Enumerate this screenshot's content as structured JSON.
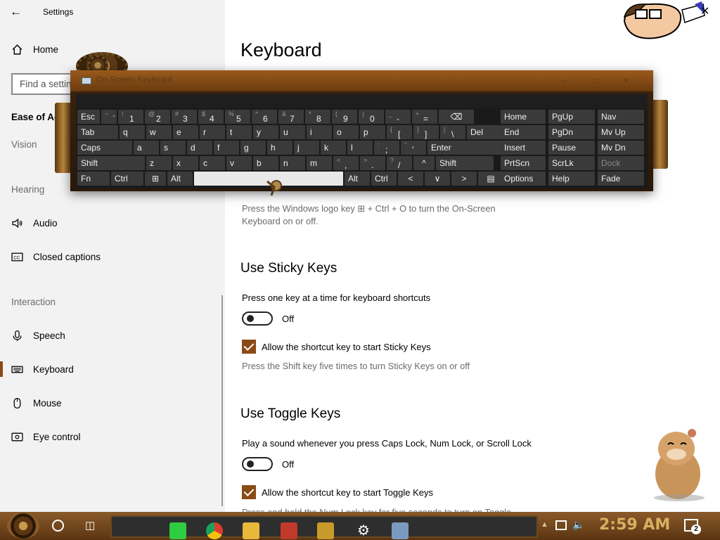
{
  "window": {
    "title": "Settings"
  },
  "sidebar": {
    "home_label": "Home",
    "search_placeholder": "Find a setting",
    "section_title": "Ease of Access",
    "vision_heading": "Vision",
    "hearing_heading": "Hearing",
    "hearing_items": [
      {
        "label": "Audio",
        "icon": "speaker-icon"
      },
      {
        "label": "Closed captions",
        "icon": "closed-captions-icon"
      }
    ],
    "interaction_heading": "Interaction",
    "interaction_items": [
      {
        "label": "Speech",
        "icon": "microphone-icon"
      },
      {
        "label": "Keyboard",
        "icon": "keyboard-icon",
        "selected": true
      },
      {
        "label": "Mouse",
        "icon": "mouse-icon"
      },
      {
        "label": "Eye control",
        "icon": "eye-control-icon"
      }
    ]
  },
  "main": {
    "title": "Keyboard",
    "osk_help_line1": "Press the Windows logo key ⊞ + Ctrl + O to turn the On-Screen",
    "osk_help_line2": "Keyboard on or off.",
    "sticky": {
      "title": "Use Sticky Keys",
      "desc": "Press one key at a time for keyboard shortcuts",
      "toggle_state": "Off",
      "checkbox_label": "Allow the shortcut key to start Sticky Keys",
      "checkbox_checked": true,
      "hint": "Press the Shift key five times to turn Sticky Keys on or off"
    },
    "toggle": {
      "title": "Use Toggle Keys",
      "desc": "Play a sound whenever you press Caps Lock, Num Lock, or Scroll Lock",
      "toggle_state": "Off",
      "checkbox_label": "Allow the shortcut key to start Toggle Keys",
      "checkbox_checked": true,
      "hint": "Press and hold the Num Lock key for five seconds to turn on Toggle"
    }
  },
  "osk": {
    "title": "On-Screen Keyboard",
    "rows": [
      [
        {
          "m": "Esc"
        },
        {
          "s": "~",
          "m": "`"
        },
        {
          "s": "!",
          "m": "1"
        },
        {
          "s": "@",
          "m": "2"
        },
        {
          "s": "#",
          "m": "3"
        },
        {
          "s": "$",
          "m": "4"
        },
        {
          "s": "%",
          "m": "5"
        },
        {
          "s": "^",
          "m": "6"
        },
        {
          "s": "&",
          "m": "7"
        },
        {
          "s": "*",
          "m": "8"
        },
        {
          "s": "(",
          "m": "9"
        },
        {
          "s": ")",
          "m": "0"
        },
        {
          "s": "_",
          "m": "-"
        },
        {
          "s": "+",
          "m": "="
        },
        {
          "m": "⌫"
        }
      ],
      [
        {
          "m": "Tab"
        },
        {
          "m": "q"
        },
        {
          "m": "w"
        },
        {
          "m": "e"
        },
        {
          "m": "r"
        },
        {
          "m": "t"
        },
        {
          "m": "y"
        },
        {
          "m": "u"
        },
        {
          "m": "i"
        },
        {
          "m": "o"
        },
        {
          "m": "p"
        },
        {
          "s": "{",
          "m": "["
        },
        {
          "s": "}",
          "m": "]"
        },
        {
          "s": "|",
          "m": "\\"
        },
        {
          "m": "Del"
        }
      ],
      [
        {
          "m": "Caps"
        },
        {
          "m": "a"
        },
        {
          "m": "s"
        },
        {
          "m": "d"
        },
        {
          "m": "f"
        },
        {
          "m": "g"
        },
        {
          "m": "h"
        },
        {
          "m": "j"
        },
        {
          "m": "k"
        },
        {
          "m": "l"
        },
        {
          "s": ":",
          "m": ";"
        },
        {
          "s": "\"",
          "m": "'"
        },
        {
          "m": "Enter"
        }
      ],
      [
        {
          "m": "Shift"
        },
        {
          "m": "z"
        },
        {
          "m": "x"
        },
        {
          "m": "c"
        },
        {
          "m": "v"
        },
        {
          "m": "b"
        },
        {
          "m": "n"
        },
        {
          "m": "m"
        },
        {
          "s": "<",
          "m": ","
        },
        {
          "s": ">",
          "m": "."
        },
        {
          "s": "?",
          "m": "/"
        },
        {
          "m": "^"
        },
        {
          "m": "Shift"
        }
      ],
      [
        {
          "m": "Fn"
        },
        {
          "m": "Ctrl"
        },
        {
          "m": "⊞"
        },
        {
          "m": "Alt"
        },
        {
          "m": ""
        },
        {
          "m": "Alt"
        },
        {
          "m": "Ctrl"
        },
        {
          "m": "<"
        },
        {
          "m": "∨"
        },
        {
          "m": ">"
        },
        {
          "m": "▤"
        }
      ]
    ],
    "nav_rows": [
      [
        {
          "m": "Home"
        },
        {
          "m": "PgUp"
        },
        {
          "m": "Nav"
        }
      ],
      [
        {
          "m": "End"
        },
        {
          "m": "PgDn"
        },
        {
          "m": "Mv Up"
        }
      ],
      [
        {
          "m": "Insert"
        },
        {
          "m": "Pause"
        },
        {
          "m": "Mv Dn"
        }
      ],
      [
        {
          "m": "PrtScn"
        },
        {
          "m": "ScrLk"
        },
        {
          "m": "Dock"
        }
      ],
      [
        {
          "m": "Options"
        },
        {
          "m": "Help"
        },
        {
          "m": "Fade"
        }
      ]
    ]
  },
  "taskbar": {
    "apps": [
      {
        "name": "notes-app-icon",
        "color": "#2ecc40"
      },
      {
        "name": "chrome-icon",
        "color": "#dd3b2f"
      },
      {
        "name": "file-explorer-icon",
        "color": "#e8b83a"
      },
      {
        "name": "red-app-icon",
        "color": "#c0392b"
      },
      {
        "name": "game-app-icon",
        "color": "#c89a2a"
      },
      {
        "name": "settings-icon",
        "color": "#ffffff"
      },
      {
        "name": "on-screen-keyboard-icon",
        "color": "#7a9ac0"
      }
    ],
    "clock": "2:59 AM",
    "notification_count": "2"
  },
  "colors": {
    "accent": "#8a4a14",
    "taskbar": "#7a4a1e",
    "osk_frame": "#3b240f"
  }
}
